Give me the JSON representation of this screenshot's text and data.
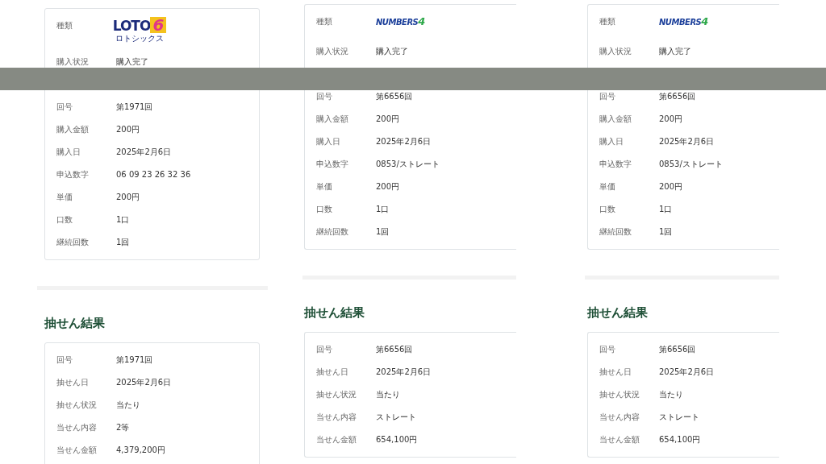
{
  "columns": [
    {
      "purchase": {
        "logo_row": {
          "label": "種類",
          "logo": {
            "kind": "loto6",
            "word": "LOTO",
            "digit": "6",
            "sub": "ロトシックス"
          }
        },
        "rows_above": [
          {
            "label": "購入状況",
            "value": "購入完了"
          }
        ],
        "rows_below": [
          {
            "label": "回号",
            "value": "第1971回"
          },
          {
            "label": "購入金額",
            "value": "200円"
          },
          {
            "label": "購入日",
            "value": "2025年2月6日"
          },
          {
            "label": "申込数字",
            "value": "06 09 23 26 32 36"
          },
          {
            "label": "単価",
            "value": "200円"
          },
          {
            "label": "口数",
            "value": "1口"
          },
          {
            "label": "継続回数",
            "value": "1回"
          }
        ]
      },
      "result": {
        "heading": "抽せん結果",
        "rows": [
          {
            "label": "回号",
            "value": "第1971回"
          },
          {
            "label": "抽せん日",
            "value": "2025年2月6日"
          },
          {
            "label": "抽せん状況",
            "value": "当たり"
          },
          {
            "label": "当せん内容",
            "value": "2等"
          },
          {
            "label": "当せん金額",
            "value": "4,379,200円"
          }
        ]
      }
    },
    {
      "purchase": {
        "logo_row": {
          "label": "種類",
          "logo": {
            "kind": "numbers4",
            "word": "NUMBERS",
            "digit": "4"
          }
        },
        "rows_above": [
          {
            "label": "購入状況",
            "value": "購入完了"
          }
        ],
        "rows_below": [
          {
            "label": "回号",
            "value": "第6656回"
          },
          {
            "label": "購入金額",
            "value": "200円"
          },
          {
            "label": "購入日",
            "value": "2025年2月6日"
          },
          {
            "label": "申込数字",
            "value": "0853/ストレート"
          },
          {
            "label": "単価",
            "value": "200円"
          },
          {
            "label": "口数",
            "value": "1口"
          },
          {
            "label": "継続回数",
            "value": "1回"
          }
        ]
      },
      "result": {
        "heading": "抽せん結果",
        "rows": [
          {
            "label": "回号",
            "value": "第6656回"
          },
          {
            "label": "抽せん日",
            "value": "2025年2月6日"
          },
          {
            "label": "抽せん状況",
            "value": "当たり"
          },
          {
            "label": "当せん内容",
            "value": "ストレート"
          },
          {
            "label": "当せん金額",
            "value": "654,100円"
          }
        ]
      }
    },
    {
      "purchase": {
        "logo_row": {
          "label": "種類",
          "logo": {
            "kind": "numbers4",
            "word": "NUMBERS",
            "digit": "4"
          }
        },
        "rows_above": [
          {
            "label": "購入状況",
            "value": "購入完了"
          }
        ],
        "rows_below": [
          {
            "label": "回号",
            "value": "第6656回"
          },
          {
            "label": "購入金額",
            "value": "200円"
          },
          {
            "label": "購入日",
            "value": "2025年2月6日"
          },
          {
            "label": "申込数字",
            "value": "0853/ストレート"
          },
          {
            "label": "単価",
            "value": "200円"
          },
          {
            "label": "口数",
            "value": "1口"
          },
          {
            "label": "継続回数",
            "value": "1回"
          }
        ]
      },
      "result": {
        "heading": "抽せん結果",
        "rows": [
          {
            "label": "回号",
            "value": "第6656回"
          },
          {
            "label": "抽せん日",
            "value": "2025年2月6日"
          },
          {
            "label": "抽せん状況",
            "value": "当たり"
          },
          {
            "label": "当せん内容",
            "value": "ストレート"
          },
          {
            "label": "当せん金額",
            "value": "654,100円"
          }
        ]
      }
    }
  ]
}
